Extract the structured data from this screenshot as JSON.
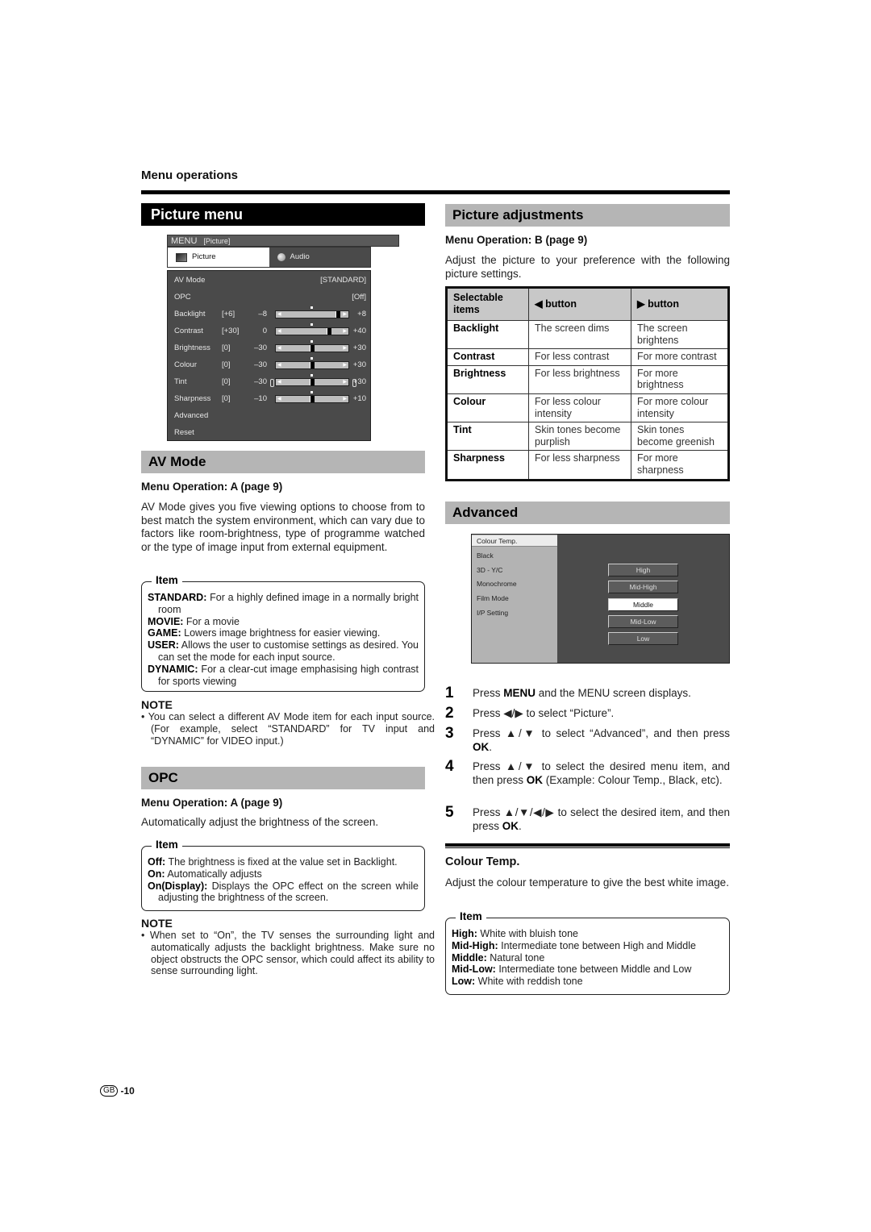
{
  "header": {
    "section_label": "Menu operations",
    "page_number": "-10",
    "region_badge": "GB"
  },
  "picture_menu": {
    "title": "Picture menu",
    "tv_menu": {
      "title": "MENU",
      "title_sub": "[Picture]",
      "tabs": [
        {
          "label": "Picture",
          "icon": "tv-icon",
          "active": true
        },
        {
          "label": "Audio",
          "icon": "speaker-icon",
          "active": false
        }
      ],
      "rows": [
        {
          "label": "AV Mode",
          "value": "[STANDARD]"
        },
        {
          "label": "OPC",
          "value": "[Off]"
        },
        {
          "label": "Backlight",
          "current": "[+6]",
          "min": "–8",
          "max": "+8",
          "level": 0.875
        },
        {
          "label": "Contrast",
          "current": "[+30]",
          "min": "0",
          "max": "+40",
          "level": 0.75
        },
        {
          "label": "Brightness",
          "current": "[0]",
          "min": "–30",
          "max": "+30",
          "level": 0.5
        },
        {
          "label": "Colour",
          "current": "[0]",
          "min": "–30",
          "max": "+30",
          "level": 0.5
        },
        {
          "label": "Tint",
          "current": "[0]",
          "min": "–30",
          "max": "+30",
          "level": 0.5
        },
        {
          "label": "Sharpness",
          "current": "[0]",
          "min": "–10",
          "max": "+10",
          "level": 0.5
        },
        {
          "label": "Advanced"
        },
        {
          "label": "Reset"
        }
      ]
    }
  },
  "av_mode": {
    "title": "AV Mode",
    "menu_operation": "Menu Operation: A (page 9)",
    "description": "AV Mode gives you five viewing options to choose from to best match the system environment, which can vary due to factors like room-brightness, type of programme watched or the type of image input from external equipment.",
    "item_legend": "Item",
    "items": [
      {
        "name": "STANDARD:",
        "text": " For a highly defined image in a normally bright room"
      },
      {
        "name": "MOVIE:",
        "text": " For a movie"
      },
      {
        "name": "GAME:",
        "text": " Lowers image brightness for easier viewing."
      },
      {
        "name": "USER:",
        "text": " Allows the user to customise settings as desired. You can set the mode for each input source."
      },
      {
        "name": "DYNAMIC:",
        "text": " For a clear-cut image emphasising high contrast for sports viewing"
      }
    ],
    "note_title": "NOTE",
    "note": "You can select a different AV Mode item for each input source. (For example, select “STANDARD” for TV input and “DYNAMIC” for VIDEO input.)"
  },
  "opc": {
    "title": "OPC",
    "menu_operation": "Menu Operation: A (page 9)",
    "description": "Automatically adjust the brightness of the screen.",
    "item_legend": "Item",
    "items": [
      {
        "name": "Off:",
        "text": " The brightness is fixed at the value set in Backlight."
      },
      {
        "name": "On:",
        "text": " Automatically adjusts"
      },
      {
        "name": "On(Display):",
        "text": " Displays the OPC effect on the screen while adjusting the brightness of the screen."
      }
    ],
    "note_title": "NOTE",
    "note": "When set to “On”, the TV senses the surrounding light and automatically adjusts the backlight brightness. Make sure no object obstructs the OPC sensor, which could affect its ability to sense surrounding light."
  },
  "picture_adjustments": {
    "title": "Picture adjustments",
    "menu_operation": "Menu Operation: B (page 9)",
    "description": "Adjust the picture to your preference with the following picture settings.",
    "table": {
      "headers": [
        "Selectable items",
        "◀ button",
        "▶ button"
      ],
      "rows": [
        [
          "Backlight",
          "The screen dims",
          "The screen brightens"
        ],
        [
          "Contrast",
          "For less contrast",
          "For more contrast"
        ],
        [
          "Brightness",
          "For less brightness",
          "For more brightness"
        ],
        [
          "Colour",
          "For less colour intensity",
          "For more colour intensity"
        ],
        [
          "Tint",
          "Skin tones become purplish",
          "Skin tones become greenish"
        ],
        [
          "Sharpness",
          "For less sharpness",
          "For more sharpness"
        ]
      ]
    }
  },
  "advanced": {
    "title": "Advanced",
    "menu": {
      "items": [
        "Colour Temp.",
        "Black",
        "3D - Y/C",
        "Monochrome",
        "Film Mode",
        "I/P Setting"
      ],
      "selected_item": "Colour Temp.",
      "options": [
        "High",
        "Mid-High",
        "Middle",
        "Mid-Low",
        "Low"
      ],
      "selected_option": "Middle"
    },
    "steps": [
      {
        "num": "1",
        "parts": [
          [
            "Press ",
            false
          ],
          [
            "MENU",
            true
          ],
          [
            " and the MENU screen displays.",
            false
          ]
        ]
      },
      {
        "num": "2",
        "parts": [
          [
            "Press ◀/▶ to select “Picture”.",
            false
          ]
        ]
      },
      {
        "num": "3",
        "parts": [
          [
            "Press ▲/▼ to select “Advanced”, and then press ",
            false
          ],
          [
            "OK",
            true
          ],
          [
            ".",
            false
          ]
        ]
      },
      {
        "num": "4",
        "parts": [
          [
            "Press ▲/▼ to select the desired menu item, and then press ",
            false
          ],
          [
            "OK",
            true
          ],
          [
            " (Example: Colour Temp., Black, etc).",
            false
          ]
        ]
      },
      {
        "num": "5",
        "parts": [
          [
            "Press ▲/▼/◀/▶ to select the desired item, and then press ",
            false
          ],
          [
            "OK",
            true
          ],
          [
            ".",
            false
          ]
        ]
      }
    ]
  },
  "colour_temp": {
    "title": "Colour Temp.",
    "description": "Adjust the colour temperature to give the best white image.",
    "item_legend": "Item",
    "items": [
      {
        "name": "High:",
        "text": " White with bluish tone"
      },
      {
        "name": "Mid-High:",
        "text": " Intermediate tone between High and Middle"
      },
      {
        "name": "Middle:",
        "text": " Natural tone"
      },
      {
        "name": "Mid-Low:",
        "text": " Intermediate tone between Middle and Low"
      },
      {
        "name": "Low:",
        "text": " White with reddish tone"
      }
    ]
  }
}
